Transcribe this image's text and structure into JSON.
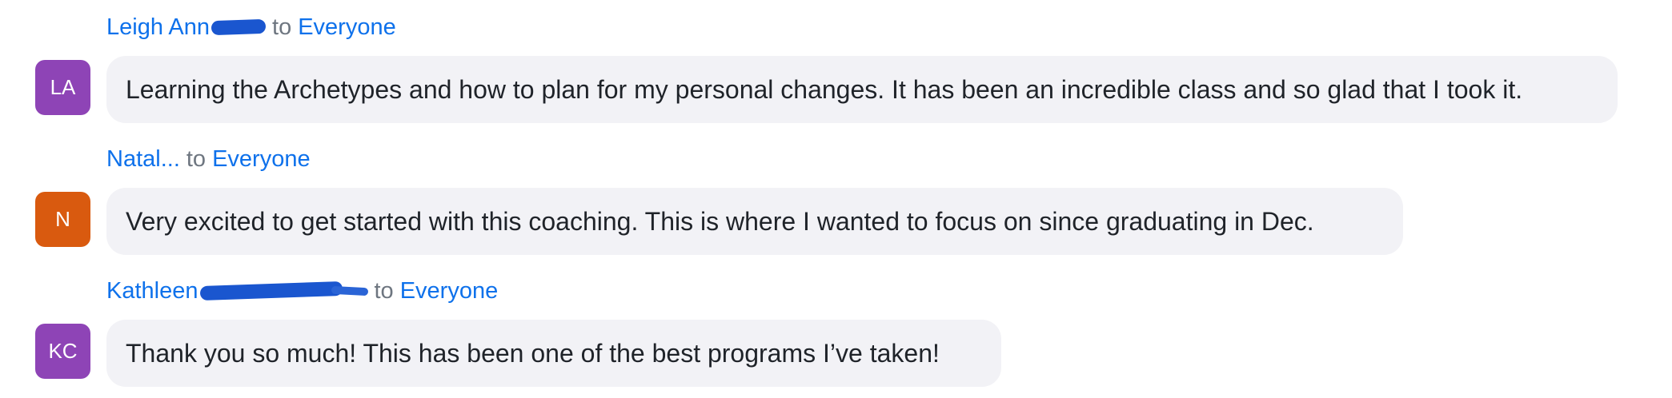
{
  "messages": [
    {
      "sender": "Leigh Ann",
      "to_word": "to",
      "recipient": "Everyone",
      "avatar_initials": "LA",
      "avatar_color": "#8e44b6",
      "text": "Learning the Archetypes and how to plan for my personal changes.  It has been an incredible class and so glad that I took it."
    },
    {
      "sender": "Natal...",
      "to_word": "to",
      "recipient": "Everyone",
      "avatar_initials": "N",
      "avatar_color": "#d95a0f",
      "text": "Very excited to get started with this coaching.  This is where I wanted to focus on since graduating in Dec."
    },
    {
      "sender": "Kathleen",
      "to_word": "to",
      "recipient": "Everyone",
      "avatar_initials": "KC",
      "avatar_color": "#8e44b6",
      "text": "Thank you so much!  This has been one of the best programs I’ve taken!"
    }
  ],
  "colors": {
    "link_blue": "#0e71eb",
    "bubble_bg": "#f2f2f6",
    "redaction_marker": "#1a56cf"
  }
}
